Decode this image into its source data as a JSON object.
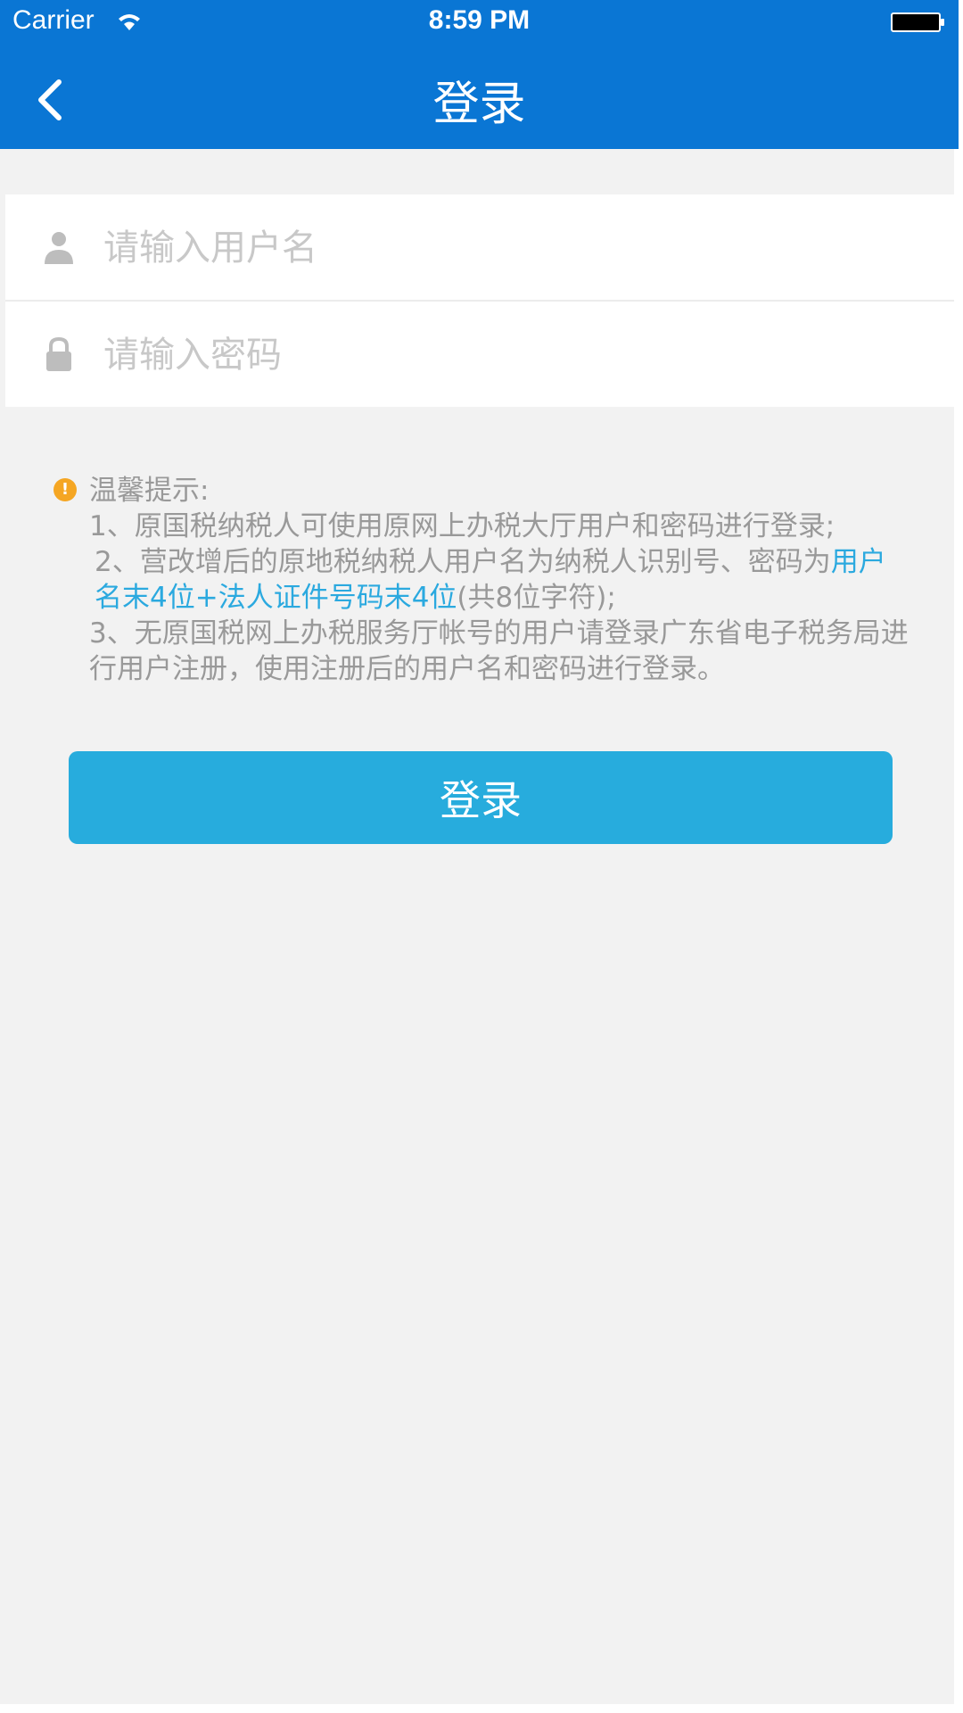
{
  "status_bar": {
    "carrier": "Carrier",
    "time": "8:59 PM"
  },
  "nav": {
    "title": "登录"
  },
  "form": {
    "username_placeholder": "请输入用户名",
    "password_placeholder": "请输入密码"
  },
  "tips": {
    "heading": "温馨提示:",
    "line1": "1、原国税纳税人可使用原网上办税大厅用户和密码进行登录;",
    "line2_prefix": "2、营改增后的原地税纳税人用户名为纳税人识别号、密码为",
    "line2_highlight": "用户名末4位+法人证件号码末4位",
    "line2_suffix": "(共8位字符);",
    "line3": "3、无原国税网上办税服务厅帐号的用户请登录广东省电子税务局进行用户注册，使用注册后的用户名和密码进行登录。"
  },
  "login_button": {
    "label": "登录"
  },
  "colors": {
    "header": "#0a76d4",
    "button": "#27acdd",
    "highlight": "#2ba9df",
    "tip_icon": "#f5a623",
    "background": "#f2f2f2"
  }
}
